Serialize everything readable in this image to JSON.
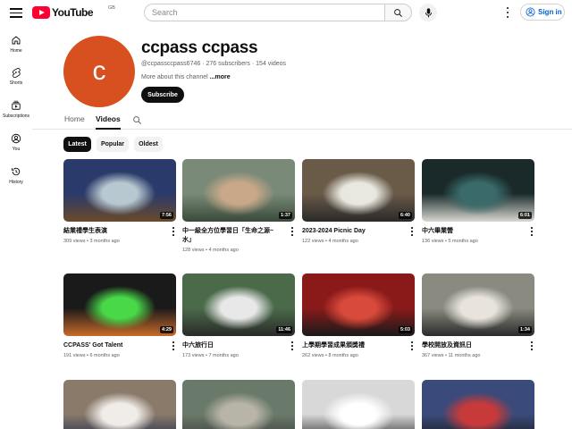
{
  "topbar": {
    "logo_text": "YouTube",
    "country_code": "GB",
    "search_placeholder": "Search",
    "signin_label": "Sign in"
  },
  "sidebar": {
    "items": [
      {
        "label": "Home"
      },
      {
        "label": "Shorts"
      },
      {
        "label": "Subscriptions"
      },
      {
        "label": "You"
      },
      {
        "label": "History"
      }
    ]
  },
  "channel": {
    "avatar_letter": "c",
    "avatar_color": "#d8501f",
    "name": "ccpass ccpass",
    "handle": "@ccpassccpass6746",
    "subscribers": "276 subscribers",
    "video_count": "154 videos",
    "about_text": "More about this channel",
    "about_more": "...more",
    "subscribe_label": "Subscribe"
  },
  "tabs": [
    {
      "label": "Home",
      "active": false
    },
    {
      "label": "Videos",
      "active": true
    }
  ],
  "chips": [
    {
      "label": "Latest",
      "active": true
    },
    {
      "label": "Popular",
      "active": false
    },
    {
      "label": "Oldest",
      "active": false
    }
  ],
  "videos": [
    {
      "title": "結業禮學生表演",
      "views": "309 views",
      "age": "3 months ago",
      "duration": "7:56",
      "palette": [
        "#2a3a6a",
        "#b8c8d0",
        "#6a4a2a"
      ]
    },
    {
      "title": "中一級全方位學習日「生命之源~水」",
      "views": "128 views",
      "age": "4 months ago",
      "duration": "1:37",
      "palette": [
        "#7a8a78",
        "#c8a888",
        "#3a4a3a"
      ]
    },
    {
      "title": "2023-2024 Picnic Day",
      "views": "122 views",
      "age": "4 months ago",
      "duration": "6:40",
      "palette": [
        "#6a5a48",
        "#e8e8e0",
        "#2a2a2a"
      ]
    },
    {
      "title": "中六畢業營",
      "views": "136 views",
      "age": "5 months ago",
      "duration": "6:01",
      "palette": [
        "#1a2a2a",
        "#3a6a6a",
        "#d8d8d0"
      ]
    },
    {
      "title": "CCPASS' Got Talent",
      "views": "191 views",
      "age": "6 months ago",
      "duration": "4:29",
      "palette": [
        "#1a1a1a",
        "#48d848",
        "#c86a2a"
      ]
    },
    {
      "title": "中六旅行日",
      "views": "173 views",
      "age": "7 months ago",
      "duration": "11:46",
      "palette": [
        "#4a6a4a",
        "#e8e8e8",
        "#2a2a2a"
      ]
    },
    {
      "title": "上學期學習成果頒獎禮",
      "views": "262 views",
      "age": "8 months ago",
      "duration": "5:03",
      "palette": [
        "#8a1a1a",
        "#d84a3a",
        "#1a1a1a"
      ]
    },
    {
      "title": "學校開放及資訊日",
      "views": "367 views",
      "age": "11 months ago",
      "duration": "1:34",
      "palette": [
        "#8a8a80",
        "#e8e4dc",
        "#2a2a2a"
      ]
    },
    {
      "title": "",
      "views": "",
      "age": "",
      "duration": "",
      "palette": [
        "#8a7a6a",
        "#f0ece8",
        "#1a2a4a"
      ]
    },
    {
      "title": "",
      "views": "",
      "age": "",
      "duration": "",
      "palette": [
        "#6a7a6a",
        "#b8b4a8",
        "#3a3a3a"
      ]
    },
    {
      "title": "",
      "views": "",
      "age": "",
      "duration": "",
      "palette": [
        "#d8d8d8",
        "#ffffff",
        "#2a2a2a"
      ]
    },
    {
      "title": "",
      "views": "",
      "age": "",
      "duration": "",
      "palette": [
        "#3a4a7a",
        "#c83a3a",
        "#1a1a1a"
      ]
    }
  ]
}
